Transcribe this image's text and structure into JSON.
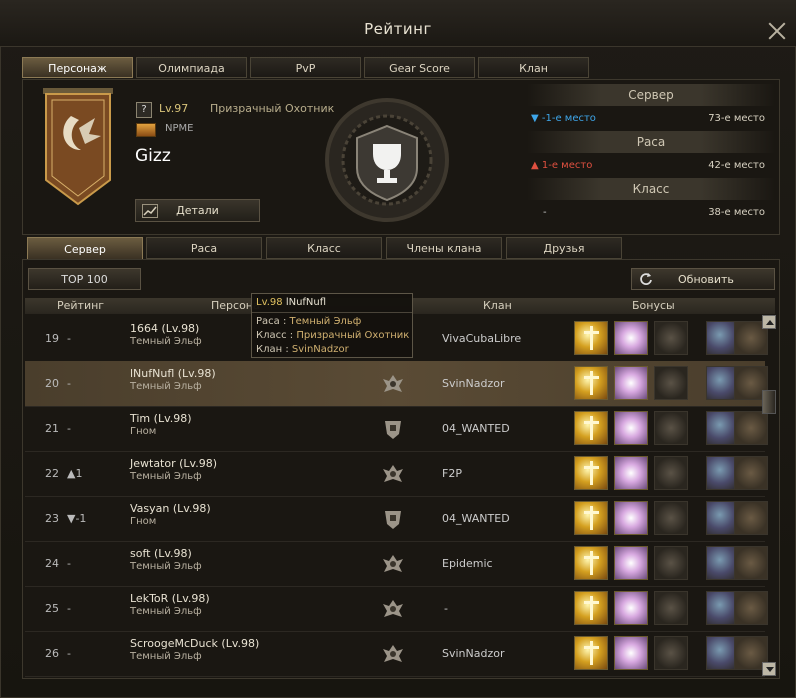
{
  "window": {
    "title": "Рейтинг"
  },
  "main_tabs": [
    "Персонаж",
    "Олимпиада",
    "PvP",
    "Gear Score",
    "Клан"
  ],
  "character": {
    "level": "Lv.97",
    "class": "Призрачный Охотник",
    "clan": "NPME",
    "name": "Gizz",
    "details_button": "Детали",
    "info_glyph": "?"
  },
  "ranks": {
    "server": {
      "header": "Сервер",
      "change": "▼ -1-е место",
      "place": "73-е место"
    },
    "race": {
      "header": "Раса",
      "change": "▲ 1-е место",
      "place": "42-е место"
    },
    "class": {
      "header": "Класс",
      "change": "-",
      "place": "38-е место"
    }
  },
  "sub_tabs": [
    "Сервер",
    "Раса",
    "Класс",
    "Члены клана",
    "Друзья"
  ],
  "top100_button": "TOP 100",
  "refresh_button": "Обновить",
  "columns": {
    "rating": "Рейтинг",
    "character": "Персона",
    "clan": "Клан",
    "bonuses": "Бонусы"
  },
  "rows": [
    {
      "rank": "19",
      "change": "-",
      "dir": "none",
      "name": "1664 (Lv.98)",
      "race": "Темный Эльф",
      "clan": "VivaCubaLibre",
      "icon": "dark-elf-crest-icon"
    },
    {
      "rank": "20",
      "change": "-",
      "dir": "none",
      "name": "lNufNufl (Lv.98)",
      "race": "Темный Эльф",
      "clan": "SvinNadzor",
      "icon": "dark-elf-crest-icon"
    },
    {
      "rank": "21",
      "change": "-",
      "dir": "none",
      "name": "Tim (Lv.98)",
      "race": "Гном",
      "clan": "04_WANTED",
      "icon": "dwarf-crest-icon"
    },
    {
      "rank": "22",
      "change": "▲1",
      "dir": "up",
      "name": "Jewtator (Lv.98)",
      "race": "Темный Эльф",
      "clan": "F2P",
      "icon": "dark-elf-crest-icon"
    },
    {
      "rank": "23",
      "change": "▼-1",
      "dir": "down",
      "name": "Vasyan (Lv.98)",
      "race": "Гном",
      "clan": "04_WANTED",
      "icon": "dwarf-crest-icon"
    },
    {
      "rank": "24",
      "change": "-",
      "dir": "none",
      "name": "soft (Lv.98)",
      "race": "Темный Эльф",
      "clan": "Epidemic",
      "icon": "dark-elf-crest-icon"
    },
    {
      "rank": "25",
      "change": "-",
      "dir": "none",
      "name": "LekToR (Lv.98)",
      "race": "Темный Эльф",
      "clan": "-",
      "icon": "dark-elf-crest-icon"
    },
    {
      "rank": "26",
      "change": "-",
      "dir": "none",
      "name": "ScroogeMcDuck (Lv.98)",
      "race": "Темный Эльф",
      "clan": "SvinNadzor",
      "icon": "dark-elf-crest-icon"
    }
  ],
  "tooltip": {
    "level": "Lv.98",
    "name": "lNufNufl",
    "race_label": "Раса :",
    "race": "Темный Эльф",
    "class_label": "Класс :",
    "class": "Призрачный Охотник",
    "clan_label": "Клан :",
    "clan": "SvinNadzor"
  },
  "colors": {
    "accent": "#d9c47a",
    "rank_up": "#e05040",
    "rank_down": "#3ea6ea"
  }
}
